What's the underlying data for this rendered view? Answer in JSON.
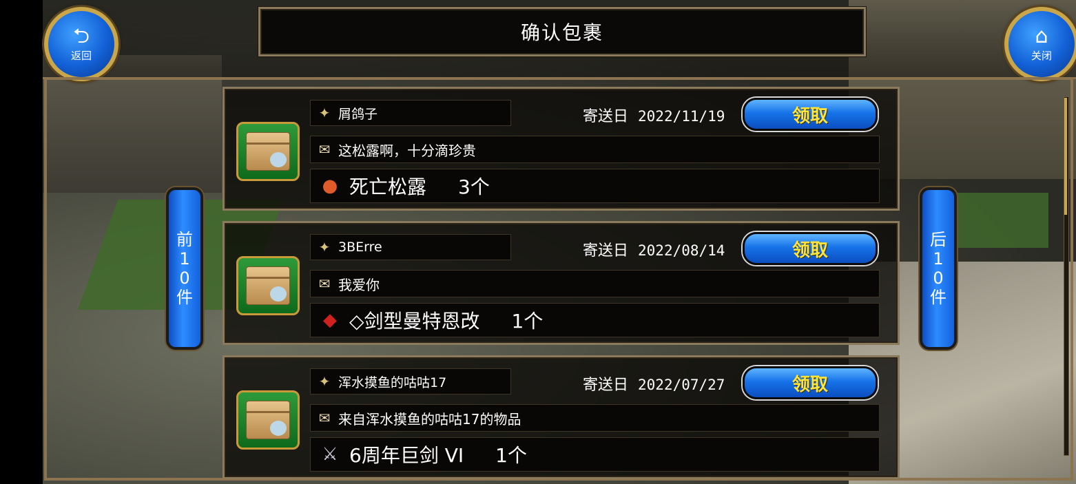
{
  "header": {
    "title": "确认包裹",
    "back_button": {
      "icon": "return-arrow-icon",
      "label": "返回"
    },
    "close_button": {
      "icon": "home-icon",
      "label": "关闭"
    }
  },
  "pager": {
    "prev_label": "前10件",
    "next_label": "后10件"
  },
  "date_label": "寄送日",
  "claim_label": "领取",
  "mails": [
    {
      "sender": "屑鸽子",
      "date": "2022/11/19",
      "message": "这松露啊，十分滴珍贵",
      "item_name": "死亡松露",
      "item_qty": "3个",
      "item_icon": "truffle-icon"
    },
    {
      "sender": "3BErre",
      "date": "2022/08/14",
      "message": "我爱你",
      "item_name": "◇剑型曼特恩改",
      "item_qty": "1个",
      "item_icon": "red-crystal-icon"
    },
    {
      "sender": "浑水摸鱼的咕咕17",
      "date": "2022/07/27",
      "message": "来自浑水摸鱼的咕咕17的物品",
      "item_name": "6周年巨剑 VI",
      "item_qty": "1个",
      "item_icon": "sword-icon"
    }
  ],
  "colors": {
    "claim_text": "#ffe43a",
    "button_blue": "#1673e8",
    "frame_gold": "#8b7a5c"
  }
}
